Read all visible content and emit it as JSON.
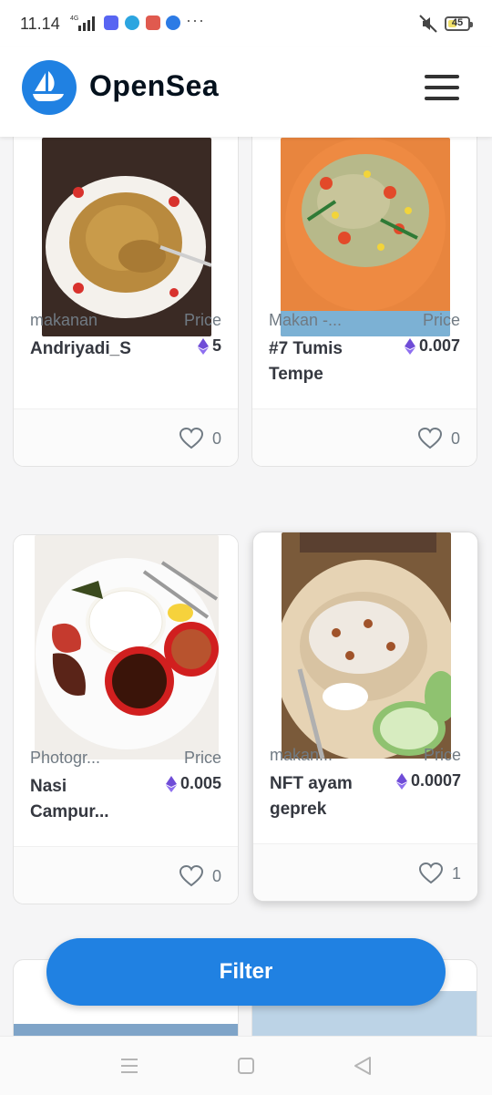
{
  "status_bar": {
    "time": "11.14",
    "network": "4G",
    "battery": "45",
    "battery_level": 0.45,
    "overflow": "···",
    "icons": [
      "signal-icon",
      "discord-icon",
      "telegram-icon",
      "game-app-icon",
      "bluetooth-app-icon",
      "mute-icon",
      "battery-icon"
    ]
  },
  "header": {
    "brand": "OpenSea",
    "logo_icon": "opensea-boat-icon",
    "menu_icon": "hamburger-menu-icon"
  },
  "colors": {
    "accent": "#2081e2",
    "text_primary": "#353840",
    "text_secondary": "#707a83",
    "eth": "#6f4cd7"
  },
  "cards": [
    {
      "collection": "makanan",
      "name": "Andriyadi_S",
      "price_label": "Price",
      "price": "5",
      "likes": "0",
      "image": "noodles-plate"
    },
    {
      "collection": "Makan -...",
      "name": "#7 Tumis Tempe",
      "price_label": "Price",
      "price": "0.007",
      "likes": "0",
      "image": "stir-fry-tempeh-plate"
    },
    {
      "collection": "Photogr...",
      "name": "Nasi Campur...",
      "price_label": "Price",
      "price": "0.005",
      "likes": "0",
      "image": "mixed-rice-plate"
    },
    {
      "collection": "makan...",
      "name": "NFT ayam geprek",
      "price_label": "Price",
      "price": "0.0007",
      "likes": "1",
      "image": "ayam-geprek-plate"
    }
  ],
  "filter_button": {
    "label": "Filter"
  },
  "nav_bar": {
    "icons": [
      "recent-apps-icon",
      "home-icon",
      "back-icon"
    ]
  }
}
